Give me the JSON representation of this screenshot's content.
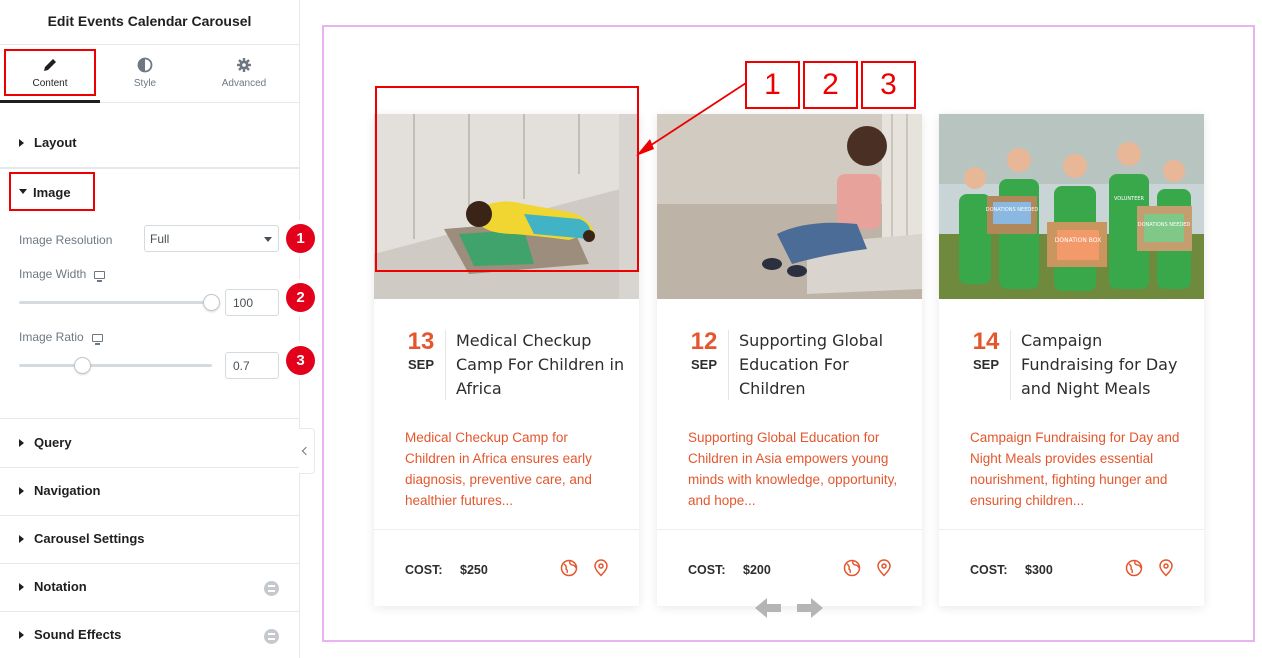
{
  "panel": {
    "title": "Edit Events Calendar Carousel",
    "tabs": [
      {
        "label": "Content",
        "icon": "pencil-icon"
      },
      {
        "label": "Style",
        "icon": "half-circle-icon"
      },
      {
        "label": "Advanced",
        "icon": "gear-icon"
      }
    ],
    "sections": {
      "layout": "Layout",
      "image": "Image",
      "query": "Query",
      "navigation": "Navigation",
      "carousel": "Carousel Settings",
      "notation": "Notation",
      "sound": "Sound Effects"
    },
    "image_controls": {
      "resolution_label": "Image Resolution",
      "resolution_value": "Full",
      "width_label": "Image Width",
      "width_value": "100",
      "width_fraction": 1.0,
      "ratio_label": "Image Ratio",
      "ratio_value": "0.7",
      "ratio_fraction": 0.33
    },
    "step_badges": [
      "1",
      "2",
      "3"
    ]
  },
  "annotations": [
    "1",
    "2",
    "3"
  ],
  "colors": {
    "accent": "#e4572e",
    "highlight": "#e00000",
    "step_red": "#e3001b",
    "preview_border": "#e8b3f0"
  },
  "events": [
    {
      "day": "13",
      "month": "SEP",
      "title": "Medical Checkup Camp For Children in Africa",
      "description": "Medical Checkup Camp for Children in Africa ensures early diagnosis, preventive care, and healthier futures...",
      "cost_label": "COST:",
      "cost": "$250"
    },
    {
      "day": "12",
      "month": "SEP",
      "title": "Supporting Global Education For Children",
      "description": "Supporting Global Education for Children in Asia empowers young minds with knowledge, opportunity, and hope...",
      "cost_label": "COST:",
      "cost": "$200"
    },
    {
      "day": "14",
      "month": "SEP",
      "title": "Campaign Fundraising for Day and Night Meals",
      "description": "Campaign Fundraising for Day and Night Meals provides essential nourishment, fighting hunger and ensuring children...",
      "cost_label": "COST:",
      "cost": "$300",
      "image_text": [
        "DONATIONS NEEDED",
        "DONATION BOX",
        "DONATIONS NEEDED",
        "VOLUNTEER"
      ]
    }
  ]
}
